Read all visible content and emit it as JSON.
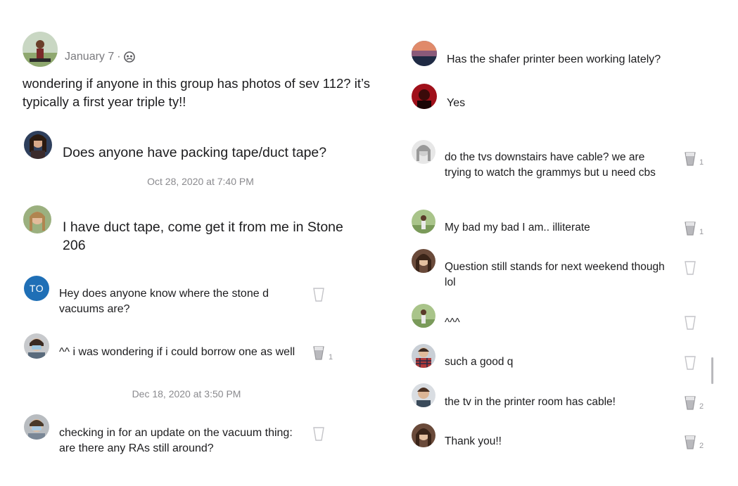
{
  "left": {
    "post": {
      "date": "January 7",
      "separator": "·",
      "text": "wondering if anyone in this group has photos of sev 112? it’s typically a first year triple ty!!"
    },
    "messages": [
      {
        "text": "Does anyone have packing tape/duct tape?"
      },
      {
        "text": "I have duct tape, come get it from me in Stone 206"
      },
      {
        "initials": "TO",
        "text": "Hey does anyone know where the stone d vacuums are?"
      },
      {
        "text": "^^ i was wondering if i could borrow one as well",
        "count": "1"
      },
      {
        "text": "checking in for an update on the vacuum thing: are there any RAs still around?"
      }
    ],
    "timestamps": [
      "Oct 28, 2020 at 7:40 PM",
      "Dec 18, 2020 at 3:50 PM"
    ]
  },
  "right": {
    "messages": [
      {
        "text": "Has the shafer printer been working lately?"
      },
      {
        "text": "Yes"
      },
      {
        "text": "do the tvs downstairs have cable? we are trying to watch the grammys but u need cbs",
        "count": "1"
      },
      {
        "text": "My bad my bad I am.. illiterate",
        "count": "1"
      },
      {
        "text": "Question still stands for next weekend though lol"
      },
      {
        "text": "^^^"
      },
      {
        "text": "such a good q"
      },
      {
        "text": "the tv in the printer room has cable!",
        "count": "2"
      },
      {
        "text": "Thank you!!",
        "count": "2"
      }
    ]
  },
  "colors": {
    "accent": "#1f6fb6",
    "muted": "#8a8a8e"
  },
  "icons": {
    "audience": "group-icon",
    "reaction": "cup-icon"
  }
}
